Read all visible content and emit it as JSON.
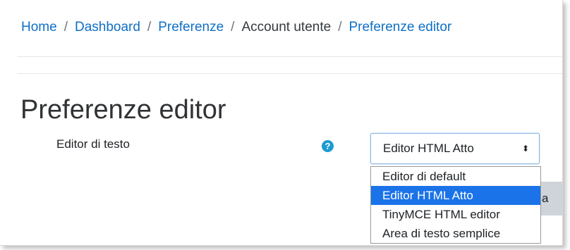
{
  "breadcrumb": {
    "items": [
      {
        "label": "Home",
        "link": true
      },
      {
        "label": "Dashboard",
        "link": true
      },
      {
        "label": "Preferenze",
        "link": true
      },
      {
        "label": "Account utente",
        "link": false
      },
      {
        "label": "Preferenze editor",
        "link": true
      }
    ],
    "separator": "/"
  },
  "page": {
    "title": "Preferenze editor"
  },
  "form": {
    "field_label": "Editor di testo",
    "help_icon": "question-circle-icon",
    "help_glyph": "?",
    "select": {
      "value": "Editor HTML Atto",
      "arrows": "⬍",
      "options": [
        {
          "label": "Editor di default",
          "selected": false
        },
        {
          "label": "Editor HTML Atto",
          "selected": true
        },
        {
          "label": "TinyMCE HTML editor",
          "selected": false
        },
        {
          "label": "Area di testo semplice",
          "selected": false
        }
      ]
    },
    "partial_button_label": "a"
  },
  "colors": {
    "link": "#0f6fc5",
    "help_icon": "#1b9bd1",
    "option_selected_bg": "#1a73e8",
    "button_bg": "#ced4da"
  }
}
